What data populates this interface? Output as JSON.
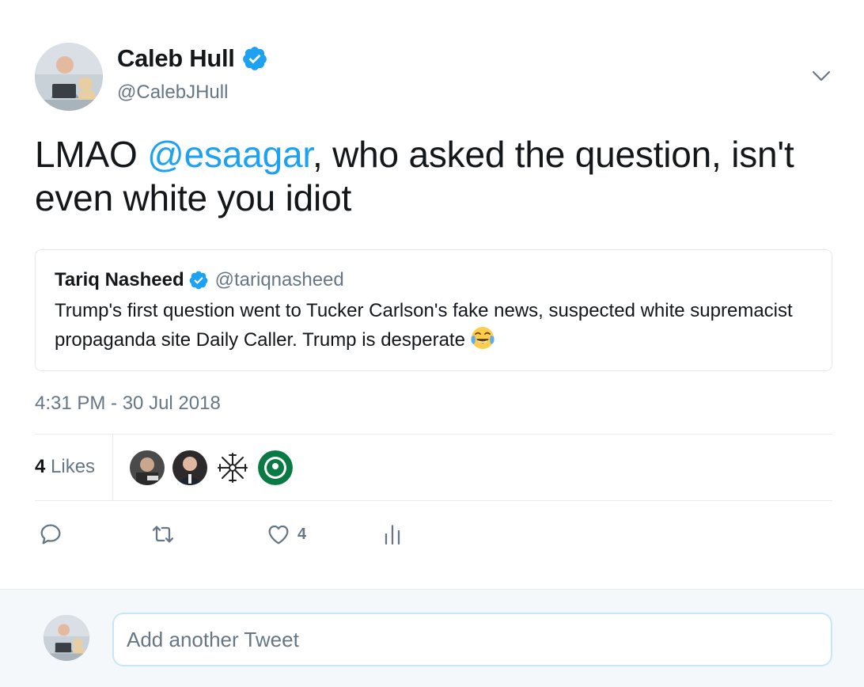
{
  "author": {
    "display_name": "Caleb Hull",
    "handle": "@CalebJHull",
    "verified": true,
    "avatar_icon": "man-with-laptop-and-dog-photo"
  },
  "tweet": {
    "text_pre": "LMAO ",
    "mention": "@esaagar",
    "text_post": ", who asked the question, isn't even white you idiot",
    "timestamp": "4:31 PM - 30 Jul 2018"
  },
  "quoted_tweet": {
    "display_name": "Tariq Nasheed",
    "handle": "@tariqnasheed",
    "verified": true,
    "text": "Trump's first question  went to Tucker Carlson's fake news, suspected white supremacist propaganda site Daily Caller. Trump is desperate",
    "emoji_icon": "face-with-tears-of-joy-emoji"
  },
  "stats": {
    "likes_count": "4",
    "likes_label": " Likes",
    "likers": [
      {
        "icon": "liker-avatar-1"
      },
      {
        "icon": "liker-avatar-2"
      },
      {
        "icon": "liker-avatar-3-rune-symbol"
      },
      {
        "icon": "liker-avatar-4-green-badge"
      }
    ]
  },
  "actions": {
    "reply_icon": "reply-icon",
    "retweet_icon": "retweet-icon",
    "like_icon": "heart-icon",
    "like_count": "4",
    "analytics_icon": "analytics-icon"
  },
  "reply": {
    "placeholder": "Add another Tweet"
  },
  "colors": {
    "accent": "#1da1f2",
    "text": "#14171a",
    "secondary": "#657786",
    "border": "#e6ecf0",
    "reply_bg": "#f5f8fa"
  }
}
